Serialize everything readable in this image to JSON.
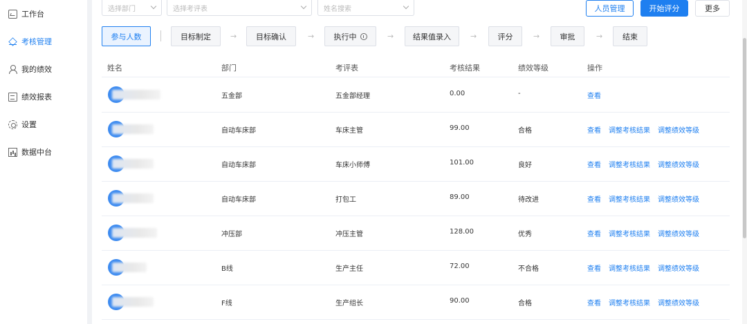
{
  "sidebar": {
    "items": [
      {
        "label": "工作台",
        "icon": "monitor-icon",
        "active": false
      },
      {
        "label": "考核管理",
        "icon": "layers-icon",
        "active": true
      },
      {
        "label": "我的绩效",
        "icon": "user-icon",
        "active": false
      },
      {
        "label": "绩效报表",
        "icon": "report-icon",
        "active": false
      },
      {
        "label": "设置",
        "icon": "gear-icon",
        "active": false
      },
      {
        "label": "数据中台",
        "icon": "chart-icon",
        "active": false
      }
    ]
  },
  "filters": {
    "department_placeholder": "选择部门",
    "form_placeholder": "选择考评表",
    "name_placeholder": "姓名搜索"
  },
  "toolbar": {
    "staff_label": "人员管理",
    "start_label": "开始评分",
    "more_label": "更多"
  },
  "steps": {
    "participants": "参与人数",
    "items": [
      "目标制定",
      "目标确认",
      "执行中",
      "结果值录入",
      "评分",
      "审批",
      "结束"
    ]
  },
  "table": {
    "headers": [
      "姓名",
      "部门",
      "考评表",
      "考核结果",
      "绩效等级",
      "操作"
    ],
    "actions": {
      "view": "查看",
      "adjust_result": "调整考核结果",
      "adjust_grade": "调整绩效等级"
    },
    "rows": [
      {
        "dept": "五金部",
        "form": "五金部经理",
        "result": "0.00",
        "grade": "-",
        "full_actions": false
      },
      {
        "dept": "自动车床部",
        "form": "车床主管",
        "result": "99.00",
        "grade": "合格",
        "full_actions": true
      },
      {
        "dept": "自动车床部",
        "form": "车床小师傅",
        "result": "101.00",
        "grade": "良好",
        "full_actions": true
      },
      {
        "dept": "自动车床部",
        "form": "打包工",
        "result": "89.00",
        "grade": "待改进",
        "full_actions": true
      },
      {
        "dept": "冲压部",
        "form": "冲压主管",
        "result": "128.00",
        "grade": "优秀",
        "full_actions": true
      },
      {
        "dept": "B线",
        "form": "生产主任",
        "result": "72.00",
        "grade": "不合格",
        "full_actions": true
      },
      {
        "dept": "F线",
        "form": "生产组长",
        "result": "90.00",
        "grade": "合格",
        "full_actions": true
      }
    ]
  },
  "colors": {
    "accent": "#1e7ff0"
  }
}
